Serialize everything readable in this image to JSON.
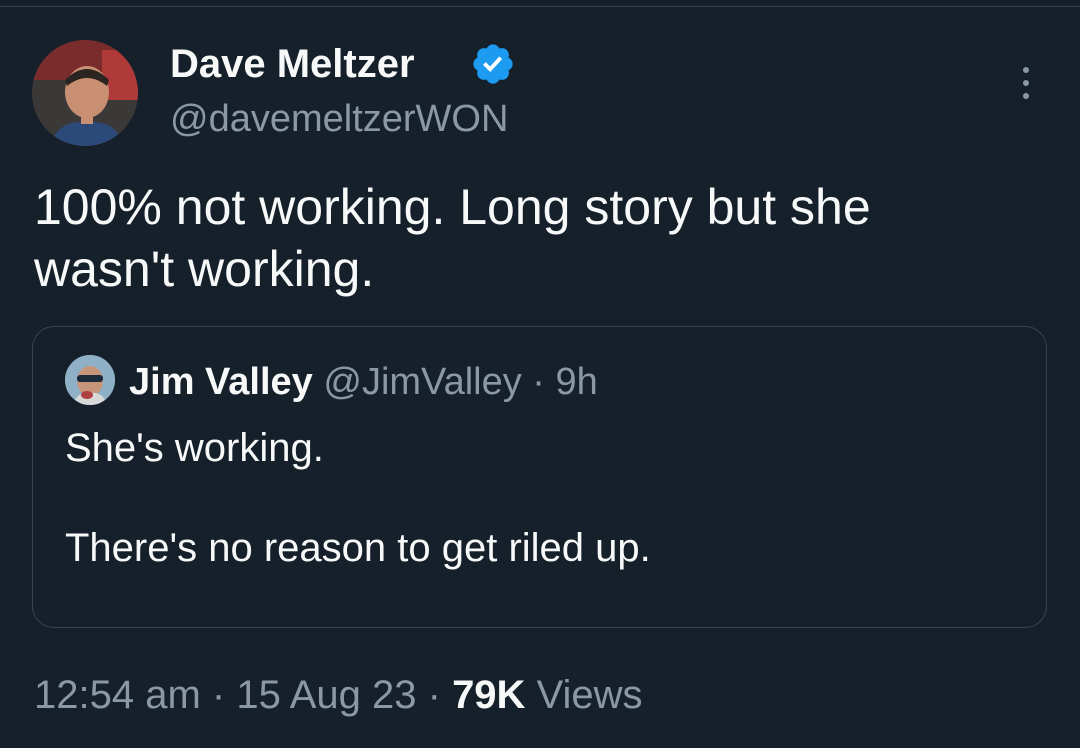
{
  "tweet": {
    "author": {
      "name": "Dave Meltzer",
      "handle": "@davemeltzerWON",
      "verified": true
    },
    "text": "100% not working.  Long story but she\nwasn't working.",
    "quote": {
      "name": "Jim Valley",
      "handle": "@JimValley",
      "separator": "·",
      "time": "9h",
      "text": "She's working.\n\nThere's no reason to get riled up."
    },
    "meta": {
      "time": "12:54 am",
      "sep1": " · ",
      "date": "15 Aug 23",
      "sep2": " · ",
      "views_count": "79K",
      "views_label": " Views"
    }
  },
  "icons": {
    "more": "more-vertical-icon",
    "verified": "verified-badge-icon"
  },
  "colors": {
    "background": "#15202b",
    "primary_text": "#f7f9f9",
    "secondary_text": "#8b98a5",
    "border": "#38444d",
    "verified_blue": "#1d9bf0"
  }
}
